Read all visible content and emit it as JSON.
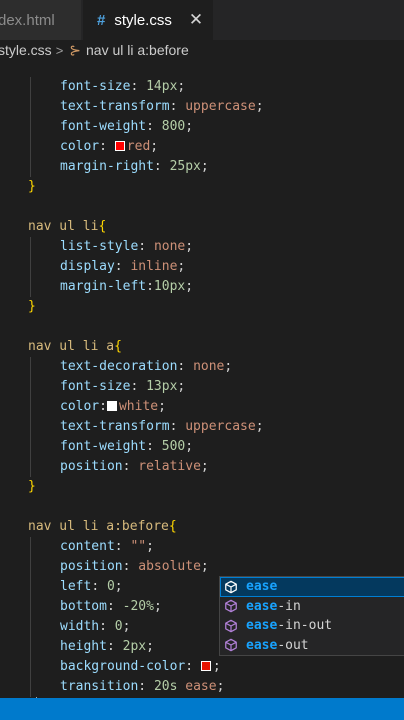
{
  "tabs": [
    {
      "label": "dex.html",
      "active": false
    },
    {
      "label": "style.css",
      "active": true,
      "icon": "hash-icon",
      "close": "✕"
    }
  ],
  "breadcrumb": {
    "file": "style.css",
    "separator": ">",
    "symbol": "nav ul li a:before"
  },
  "code_lines": [
    {
      "text": ""
    },
    {
      "indent": 1,
      "prop": "font-size",
      "value": "14px",
      "kind": "num"
    },
    {
      "indent": 1,
      "prop": "text-transform",
      "value": "uppercase",
      "kind": "val"
    },
    {
      "indent": 1,
      "prop": "font-weight",
      "value": "800",
      "kind": "num"
    },
    {
      "indent": 1,
      "prop": "color",
      "value": "red",
      "kind": "val",
      "swatch": "#ff0000"
    },
    {
      "indent": 1,
      "prop": "margin-right",
      "value": "25px",
      "kind": "num"
    },
    {
      "text": "}",
      "brace": true
    },
    {
      "text": ""
    },
    {
      "selector": "nav ul li"
    },
    {
      "indent": 1,
      "prop": "list-style",
      "value": "none",
      "kind": "val"
    },
    {
      "indent": 1,
      "prop": "display",
      "value": "inline",
      "kind": "val"
    },
    {
      "indent": 1,
      "prop": "margin-left",
      "value": "10px",
      "kind": "num",
      "tight": true
    },
    {
      "text": "}",
      "brace": true
    },
    {
      "text": ""
    },
    {
      "selector": "nav ul li a"
    },
    {
      "indent": 1,
      "prop": "text-decoration",
      "value": "none",
      "kind": "val"
    },
    {
      "indent": 1,
      "prop": "font-size",
      "value": "13px",
      "kind": "num"
    },
    {
      "indent": 1,
      "prop": "color",
      "value": "white",
      "kind": "val",
      "swatch": "#ffffff",
      "tight": true
    },
    {
      "indent": 1,
      "prop": "text-transform",
      "value": "uppercase",
      "kind": "val"
    },
    {
      "indent": 1,
      "prop": "font-weight",
      "value": "500",
      "kind": "num"
    },
    {
      "indent": 1,
      "prop": "position",
      "value": "relative",
      "kind": "val"
    },
    {
      "text": "}",
      "brace": true
    },
    {
      "text": ""
    },
    {
      "selector": "nav ul li a:before"
    },
    {
      "indent": 1,
      "prop": "content",
      "value": "\"\"",
      "kind": "val"
    },
    {
      "indent": 1,
      "prop": "position",
      "value": "absolute",
      "kind": "val"
    },
    {
      "indent": 1,
      "prop": "left",
      "value": "0",
      "kind": "num"
    },
    {
      "indent": 1,
      "prop": "bottom",
      "value": "-20%",
      "kind": "num"
    },
    {
      "indent": 1,
      "prop": "width",
      "value": "0",
      "kind": "num"
    },
    {
      "indent": 1,
      "prop": "height",
      "value": "2px",
      "kind": "num"
    },
    {
      "indent": 1,
      "prop": "background-color",
      "value": "",
      "kind": "val",
      "swatch": "#e51400"
    },
    {
      "indent": 1,
      "prop": "transition",
      "value": "20s ease",
      "kind": "mixed"
    },
    {
      "text": "}",
      "brace": true,
      "cursor": true
    }
  ],
  "autocomplete": {
    "typed": "ease",
    "items": [
      {
        "label": "ease",
        "icon": "cube-icon",
        "active": true
      },
      {
        "label": "ease-in",
        "icon": "cube-icon",
        "active": false
      },
      {
        "label": "ease-in-out",
        "icon": "cube-icon",
        "active": false
      },
      {
        "label": "ease-out",
        "icon": "cube-icon",
        "active": false
      }
    ]
  },
  "colors": {
    "accent": "#007acc",
    "editor_bg": "#1e1e1e",
    "selector": "#d7ba7d",
    "property": "#9cdcfe",
    "string": "#ce9178",
    "number": "#b5cea8"
  }
}
